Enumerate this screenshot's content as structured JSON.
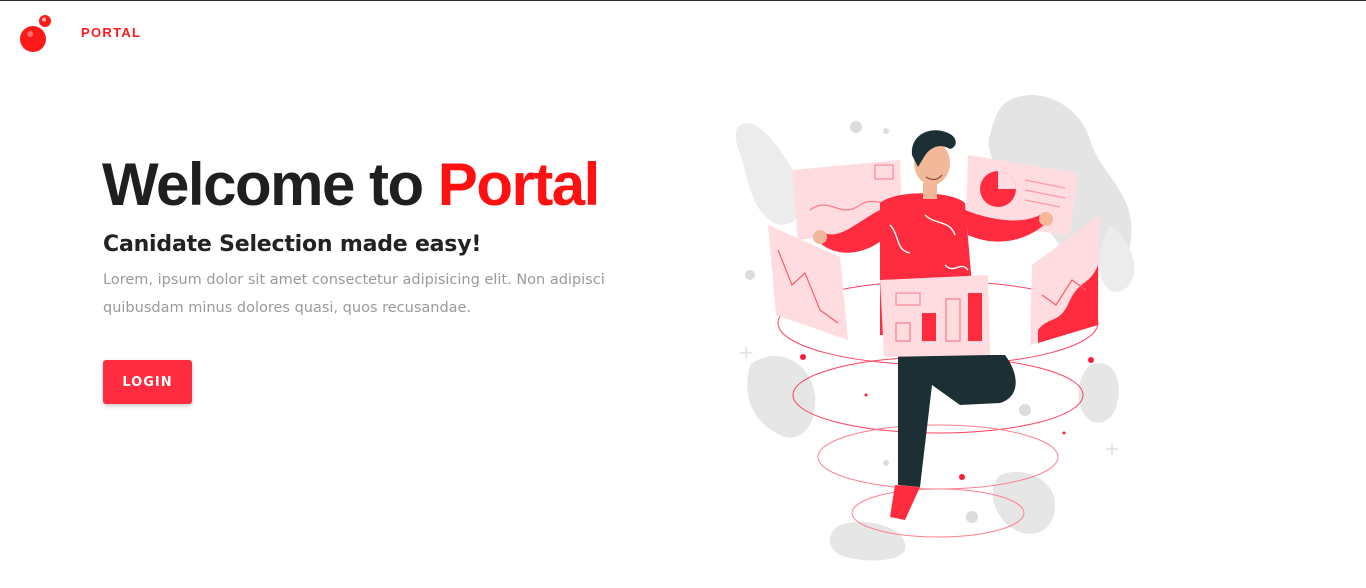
{
  "navbar": {
    "brand": "PORTAL",
    "logo_icon": "red-bubble-logo-icon"
  },
  "hero": {
    "title_prefix": "Welcome to ",
    "title_accent": "Portal",
    "subtitle": "Canidate Selection made easy!",
    "description": "Lorem, ipsum dolor sit amet consectetur adipisicing elit. Non adipisci quibusdam minus dolores quasi, quos recusandae.",
    "login_label": "LOGIN"
  },
  "illustration": {
    "icon": "analytics-person-illustration"
  },
  "colors": {
    "accent": "#ff1111",
    "button": "#ff2b3f",
    "text_dark": "#1f1f1f",
    "text_muted": "#9a9a9a"
  }
}
